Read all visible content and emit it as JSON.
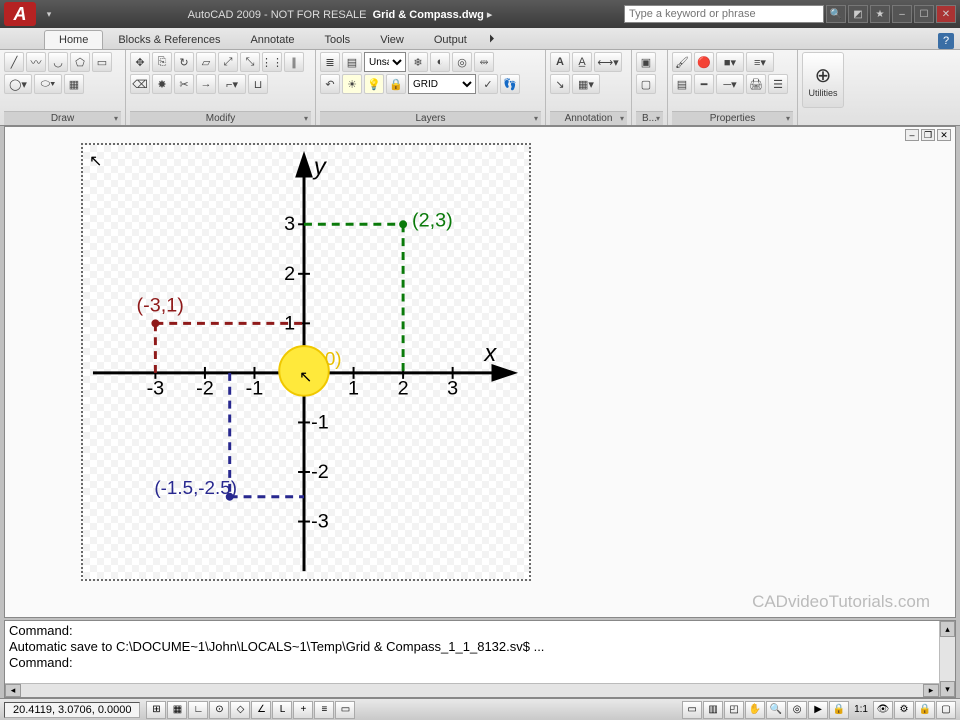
{
  "title": {
    "app": "AutoCAD 2009 - NOT FOR RESALE",
    "file": "Grid & Compass.dwg",
    "search_placeholder": "Type a keyword or phrase"
  },
  "tabs": {
    "home": "Home",
    "blocks": "Blocks & References",
    "annotate": "Annotate",
    "tools": "Tools",
    "view": "View",
    "output": "Output"
  },
  "panels": {
    "draw": "Draw",
    "modify": "Modify",
    "layers": "Layers",
    "annotation": "Annotation",
    "block": "B...",
    "properties": "Properties",
    "utilities": "Utilities"
  },
  "layers": {
    "style_option": "Unsa",
    "current": "GRID"
  },
  "commands": {
    "line1": "Command:",
    "line2": "Automatic save to C:\\DOCUME~1\\John\\LOCALS~1\\Temp\\Grid & Compass_1_1_8132.sv$ ...",
    "line3": "Command:",
    "prompt": "Command:"
  },
  "status": {
    "coords": "20.4119, 3.0706, 0.0000",
    "scale": "1:1"
  },
  "watermark": "CADvideoTutorials.com",
  "chart_data": {
    "type": "scatter",
    "xlabel": "x",
    "ylabel": "y",
    "xlim": [
      -3,
      3
    ],
    "ylim": [
      -3,
      3
    ],
    "ticks_x": [
      -3,
      -2,
      -1,
      1,
      2,
      3
    ],
    "ticks_y": [
      -3,
      -2,
      -1,
      1,
      2,
      3
    ],
    "points": [
      {
        "x": -3,
        "y": 1,
        "label": "(-3,1)",
        "color": "#8f1a1a"
      },
      {
        "x": 2,
        "y": 3,
        "label": "(2,3)",
        "color": "#0a7a0a"
      },
      {
        "x": -1.5,
        "y": -2.5,
        "label": "(-1.5,-2.5)",
        "color": "#28288f"
      },
      {
        "x": 0,
        "y": 0,
        "label": "",
        "color": "#f7d200",
        "highlight": true
      }
    ],
    "origin_highlight_label_partial": "0)"
  }
}
